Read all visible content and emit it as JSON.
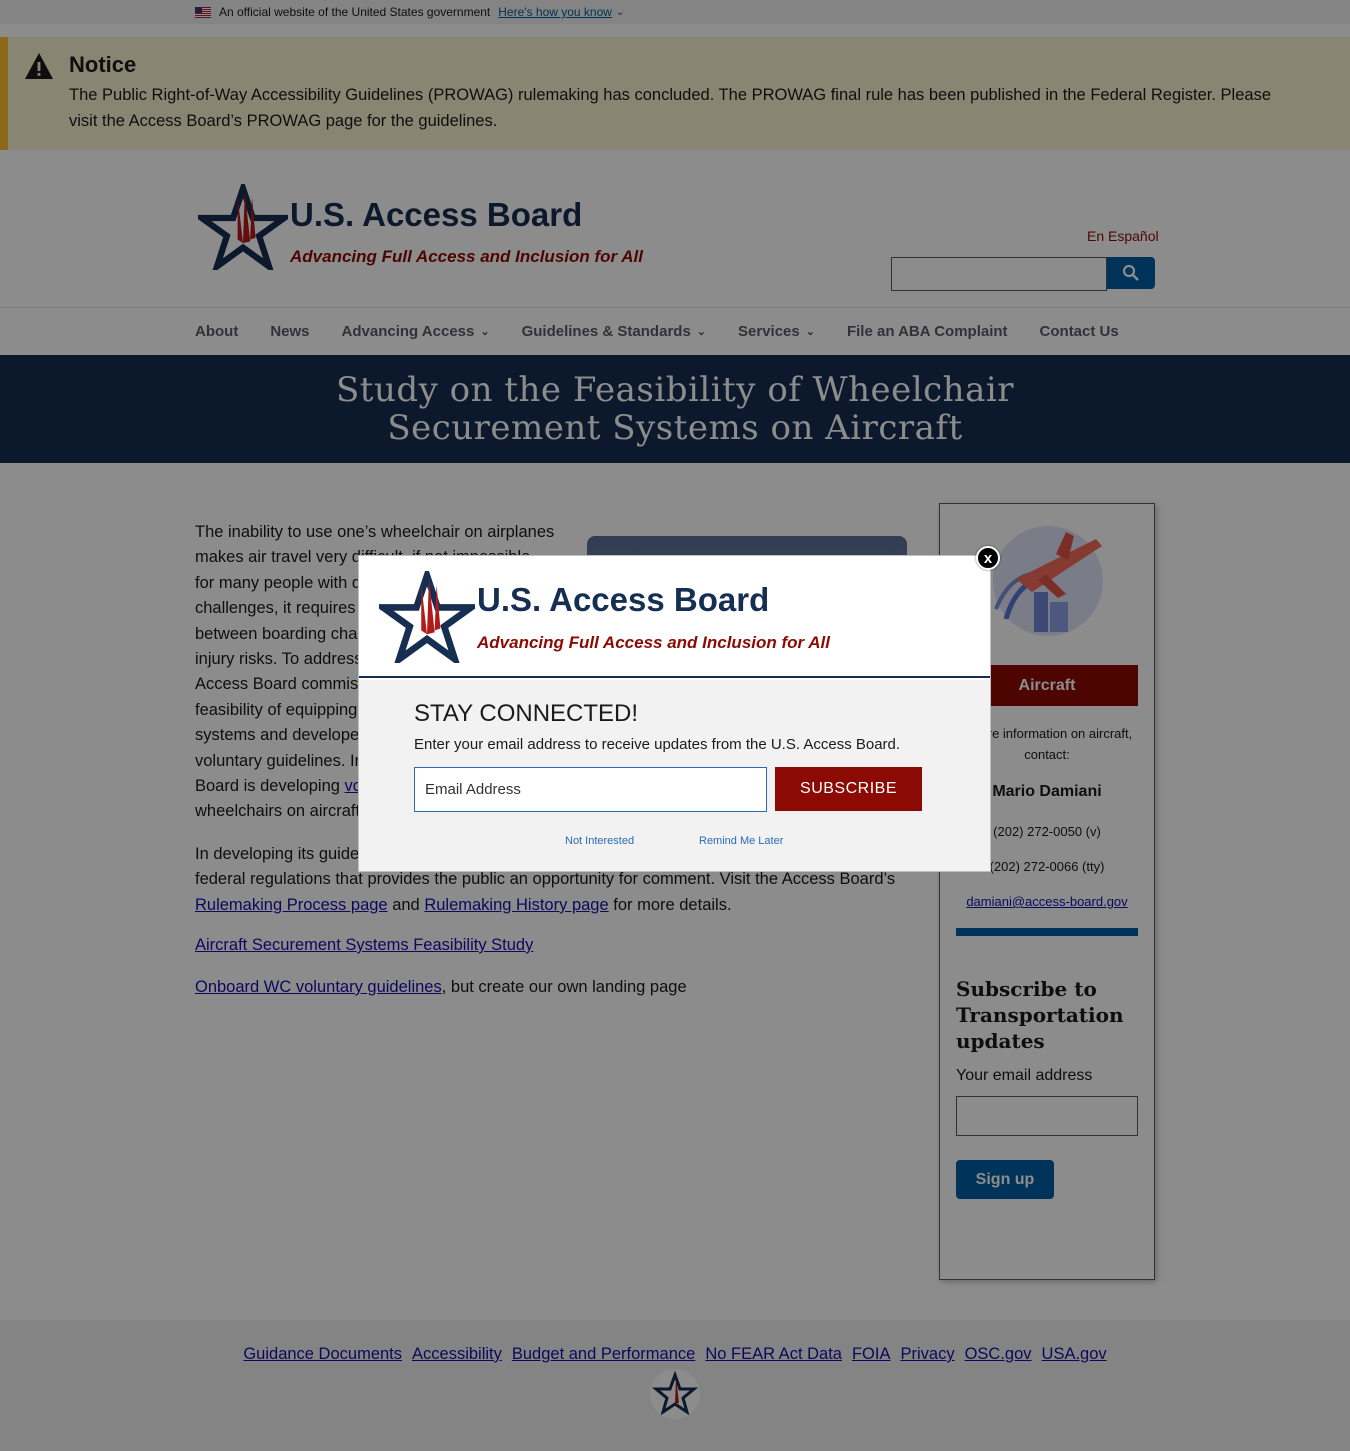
{
  "gov_banner": {
    "text": "An official website of the United States government",
    "link": "Here's how you know"
  },
  "notice": {
    "title": "Notice",
    "body": "The Public Right-of-Way Accessibility Guidelines (PROWAG) rulemaking has concluded. The PROWAG final rule has been published in the Federal Register. Please visit the Access Board’s PROWAG page for the guidelines."
  },
  "header": {
    "title": "U.S. Access Board",
    "tagline": "Advancing Full Access and Inclusion for All",
    "language_link": "En Español"
  },
  "nav": {
    "items": [
      "About",
      "News",
      "Advancing Access",
      "Guidelines & Standards",
      "Services",
      "File an ABA Complaint",
      "Contact Us"
    ]
  },
  "hero": {
    "title": "Study on the Feasibility of Wheelchair Securement Systems on Aircraft"
  },
  "main": {
    "p1_a": "The inability to use one’s wheelchair on airplanes makes air travel very difficult, if not impossible, for many people with d",
    "p1_b": "challenges, it requires",
    "p1_c": "between boarding char",
    "p1_d": "injury risks. To address",
    "p1_e": "Access Board commissi",
    "p1_f": "feasibility of equipping",
    "p1_g": "systems and developed",
    "p1_h": "voluntary guidelines. In",
    "p1_i": "Board is developing ",
    "p1_link": "vo",
    "p1_j": "wheelchairs on aircraft.",
    "p2_a": "In developing its guide",
    "p2_b": "federal regulations that provides the public an opportunity for comment. Visit the Access Board’s",
    "p2_link1": "Rulemaking Process page",
    "p2_and": " and ",
    "p2_link2": "Rulemaking History page",
    "p2_end": " for more details.",
    "link_study": "Aircraft Securement Systems Feasibility Study",
    "link_onboard": "Onboard WC voluntary guidelines",
    "onboard_suffix": ", but create our own landing page"
  },
  "sidebar": {
    "banner": "Aircraft",
    "info": "r more information on aircraft, contact:",
    "name": "Mario Damiani",
    "phone_voice": "(202) 272-0050 (v)",
    "phone_tty": "(202) 272-0066 (tty)",
    "email": "damiani@access-board.gov",
    "subscribe_title": "Subscribe to Transportation updates",
    "email_label": "Your email address",
    "signup": "Sign up"
  },
  "footer": {
    "links": [
      "Guidance Documents",
      "Accessibility",
      "Budget and Performance",
      "No FEAR Act Data",
      "FOIA",
      "Privacy",
      "OSC.gov",
      "USA.gov"
    ]
  },
  "modal": {
    "title": "U.S. Access Board",
    "tagline": "Advancing Full Access and Inclusion for All",
    "heading": "STAY CONNECTED!",
    "description": "Enter your email address to receive updates from the U.S. Access Board.",
    "email_placeholder": "Email Address",
    "subscribe": "SUBSCRIBE",
    "not_interested": "Not Interested",
    "remind_later": "Remind Me Later",
    "close": "x"
  },
  "colors": {
    "navy": "#162e51",
    "brand_red": "#8b0a03",
    "primary_blue": "#005ea2",
    "notice_bg": "#faf3d1",
    "notice_accent": "#ffbe2e"
  },
  "icons": [
    "us-flag-icon",
    "chevron-down-icon",
    "warning-icon",
    "star-logo-icon",
    "search-icon",
    "airplane-illustration",
    "close-icon"
  ]
}
